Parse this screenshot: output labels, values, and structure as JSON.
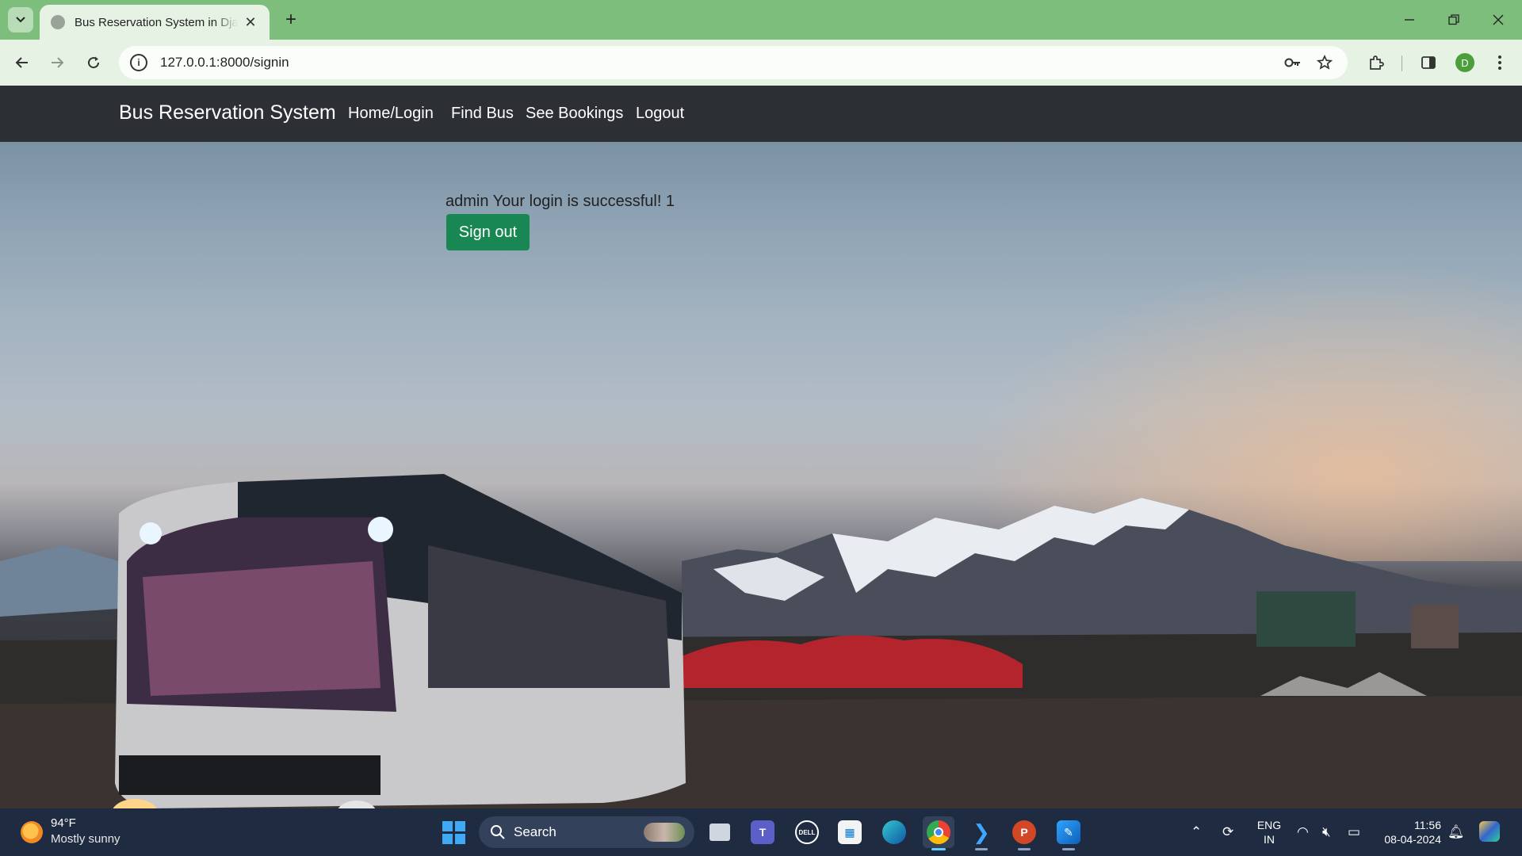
{
  "browser": {
    "tab_title": "Bus Reservation System in Django",
    "close_tab": "✕",
    "new_tab": "+",
    "url": "127.0.0.1:8000/signin",
    "profile_initial": "D"
  },
  "site": {
    "brand": "Bus Reservation System",
    "nav": [
      "Home/Login",
      "Find Bus",
      "See Bookings",
      "Logout"
    ],
    "message": "admin Your login is successful! 1",
    "signout_label": "Sign out"
  },
  "taskbar": {
    "temperature": "94°F",
    "condition": "Mostly sunny",
    "search_label": "Search",
    "language": "ENG",
    "region": "IN",
    "time": "11:56",
    "date": "08-04-2024"
  },
  "colors": {
    "tab_strip": "#7dbe7d",
    "toolbar": "#e6f3e4",
    "navbar": "#2c2f33",
    "signout_button": "#198754",
    "taskbar": "#1e2b40"
  }
}
